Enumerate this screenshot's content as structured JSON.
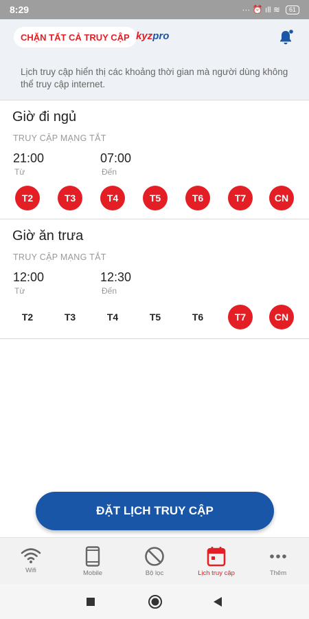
{
  "status_bar": {
    "time": "8:29",
    "indicators": "··· ⏰ ıll ≋",
    "battery": "61"
  },
  "header": {
    "block_all_label": "CHẶN TẤT CẢ TRUY CẬP",
    "brand_prefix": "kyz",
    "brand_suffix": "pro",
    "description": "Lịch truy cập hiển thị các khoảng thời gian mà người dùng không thể truy cập internet."
  },
  "schedules": [
    {
      "title": "Giờ đi ngủ",
      "subtitle": "TRUY CẬP MẠNG TẮT",
      "from_time": "21:00",
      "from_label": "Từ",
      "to_time": "07:00",
      "to_label": "Đến",
      "days": [
        {
          "label": "T2",
          "active": true
        },
        {
          "label": "T3",
          "active": true
        },
        {
          "label": "T4",
          "active": true
        },
        {
          "label": "T5",
          "active": true
        },
        {
          "label": "T6",
          "active": true
        },
        {
          "label": "T7",
          "active": true
        },
        {
          "label": "CN",
          "active": true
        }
      ]
    },
    {
      "title": "Giờ ăn trưa",
      "subtitle": "TRUY CẬP MẠNG TẮT",
      "from_time": "12:00",
      "from_label": "Từ",
      "to_time": "12:30",
      "to_label": "Đến",
      "days": [
        {
          "label": "T2",
          "active": false
        },
        {
          "label": "T3",
          "active": false
        },
        {
          "label": "T4",
          "active": false
        },
        {
          "label": "T5",
          "active": false
        },
        {
          "label": "T6",
          "active": false
        },
        {
          "label": "T7",
          "active": true
        },
        {
          "label": "CN",
          "active": true
        }
      ]
    }
  ],
  "cta_label": "ĐẶT LỊCH TRUY CẬP",
  "tabs": [
    {
      "label": "Wifi",
      "icon": "wifi-icon",
      "active": false
    },
    {
      "label": "Mobile",
      "icon": "mobile-icon",
      "active": false
    },
    {
      "label": "Bộ lọc",
      "icon": "block-icon",
      "active": false
    },
    {
      "label": "Lịch truy cập",
      "icon": "calendar-icon",
      "active": true
    },
    {
      "label": "Thêm",
      "icon": "more-icon",
      "active": false
    }
  ],
  "colors": {
    "accent_red": "#e31e24",
    "primary_blue": "#1a56a8",
    "header_bg": "#eef1f5"
  }
}
